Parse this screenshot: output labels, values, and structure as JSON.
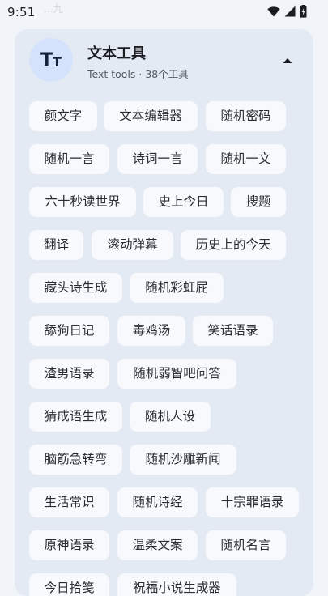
{
  "status_bar": {
    "time": "9:51",
    "faded_text": "...九"
  },
  "section": {
    "title": "文本工具",
    "subtitle": "Text tools · 38个工具",
    "avatar_letters": "TT"
  },
  "tools": [
    "颜文字",
    "文本编辑器",
    "随机密码",
    "随机一言",
    "诗词一言",
    "随机一文",
    "六十秒读世界",
    "史上今日",
    "搜题",
    "翻译",
    "滚动弹幕",
    "历史上的今天",
    "藏头诗生成",
    "随机彩虹屁",
    "舔狗日记",
    "毒鸡汤",
    "笑话语录",
    "渣男语录",
    "随机弱智吧问答",
    "猜成语生成",
    "随机人设",
    "脑筋急转弯",
    "随机沙雕新闻",
    "生活常识",
    "随机诗经",
    "十宗罪语录",
    "原神语录",
    "温柔文案",
    "随机名言",
    "今日拾笺",
    "祝福小说生成器"
  ]
}
